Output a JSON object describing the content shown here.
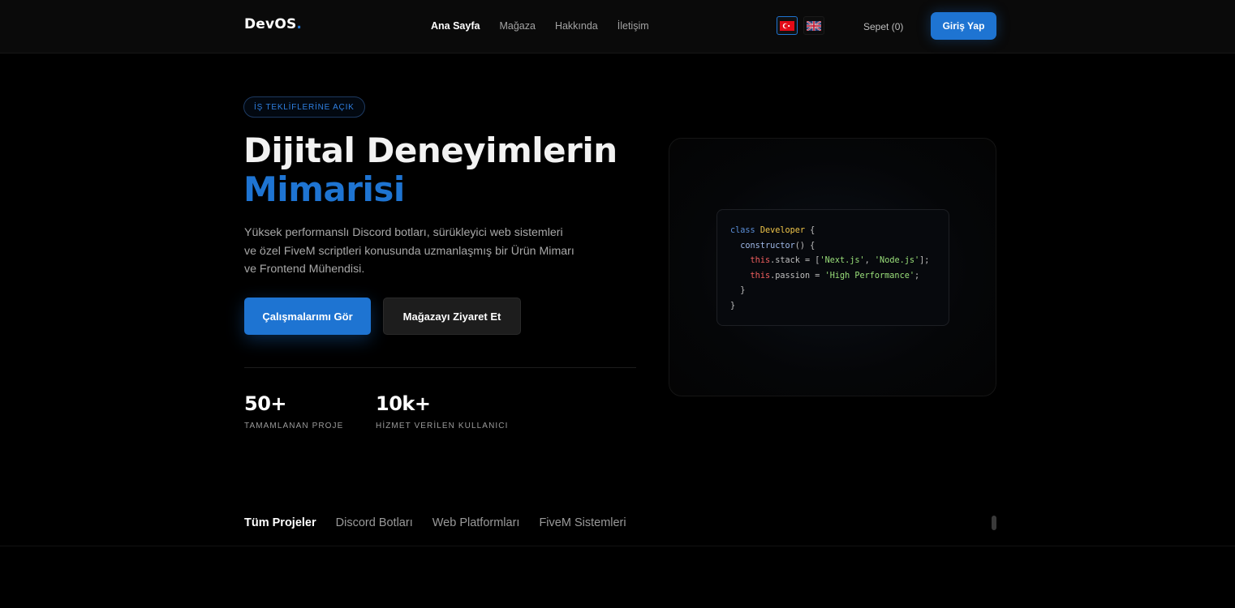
{
  "nav": {
    "logo_text": "DevOS",
    "logo_dot": ".",
    "links": [
      {
        "label": "Ana Sayfa",
        "active": true
      },
      {
        "label": "Mağaza",
        "active": false
      },
      {
        "label": "Hakkında",
        "active": false
      },
      {
        "label": "İletişim",
        "active": false
      }
    ],
    "flags": [
      "turkey-flag-icon",
      "uk-flag-icon"
    ],
    "cart": "Sepet (0)",
    "login": "Giriş Yap"
  },
  "hero": {
    "badge": "İŞ TEKLİFLERİNE AÇIK",
    "title_line1": "Dijital Deneyimlerin",
    "title_line2": "Mimarisi",
    "description": "Yüksek performanslı Discord botları, sürükleyici web sistemleri ve özel FiveM scriptleri konusunda uzmanlaşmış bir Ürün Mimarı ve Frontend Mühendisi.",
    "primary_button": "Çalışmalarımı Gör",
    "secondary_button": "Mağazayı Ziyaret Et",
    "stats": [
      {
        "value": "50+",
        "label": "TAMAMLANAN PROJE"
      },
      {
        "value": "10k+",
        "label": "HİZMET VERİLEN KULLANICI"
      }
    ]
  },
  "code": {
    "kw_class": "class",
    "class_name": "Developer",
    "brace_open": " {",
    "ctor": "constructor",
    "ctor_rest": "() {",
    "this": "this",
    "stack_prop": ".stack = [",
    "str_next": "'Next.js'",
    "comma": ", ",
    "str_node": "'Node.js'",
    "stack_end": "];",
    "passion_prop": ".passion = ",
    "str_perf": "'High Performance'",
    "semi": ";",
    "brace_close": "}"
  },
  "tabs": [
    {
      "label": "Tüm Projeler",
      "active": true
    },
    {
      "label": "Discord Botları",
      "active": false
    },
    {
      "label": "Web Platformları",
      "active": false
    },
    {
      "label": "FiveM Sistemleri",
      "active": false
    }
  ],
  "colors": {
    "accent": "#1e74d2",
    "background": "#000000",
    "navbar": "#0a0a0a"
  }
}
